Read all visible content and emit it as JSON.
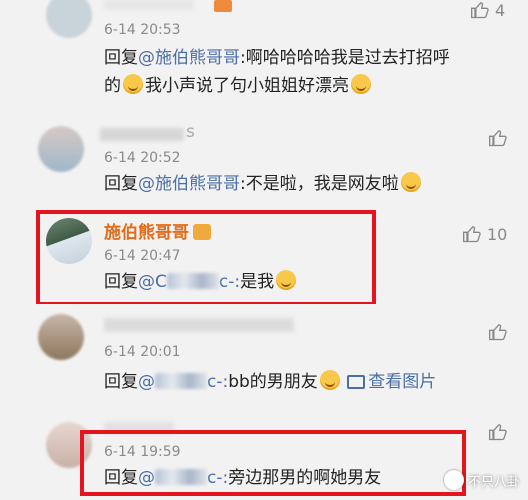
{
  "comments": [
    {
      "time": "6-14 20:53",
      "likes": "4",
      "reply_prefix": "回复",
      "mention": "@施伯熊哥哥",
      "line1": ":啊哈哈哈哈我是过去打招呼",
      "line2a": "的",
      "line2b": "我小声说了句小姐姐好漂亮"
    },
    {
      "name": "s",
      "time": "6-14 20:52",
      "reply_prefix": "回复",
      "mention": "@施伯熊哥哥",
      "text": ":不是啦，我是网友啦"
    },
    {
      "name": "施伯熊哥哥",
      "time": "6-14 20:47",
      "likes": "10",
      "reply_prefix": "回复",
      "mention": "@C",
      "mention_tail": "c-:",
      "text": "是我"
    },
    {
      "time": "6-14 20:01",
      "reply_prefix": "回复",
      "mention": "@",
      "mention_tail": "c-:",
      "text": "bb的男朋友",
      "photo_link": "查看图片"
    },
    {
      "time": "6-14 19:59",
      "reply_prefix": "回复",
      "mention": "@",
      "mention_tail": "c-:",
      "text": "旁边那男的啊她男友"
    }
  ],
  "watermark": "不只八卦",
  "colors": {
    "highlight_box": "#e3151f",
    "username": "#e36c1b",
    "mention": "#4a6fa5"
  }
}
